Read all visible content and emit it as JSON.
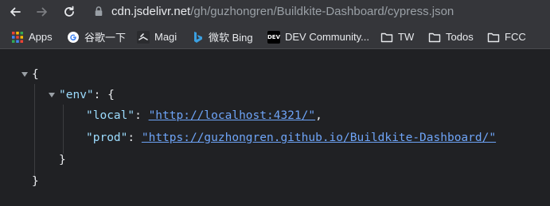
{
  "browser": {
    "url_host": "cdn.jsdelivr.net",
    "url_path": "/gh/guzhongren/Buildkite-Dashboard/cypress.json"
  },
  "bookmarks": [
    {
      "label": "Apps",
      "icon": "apps-grid-icon"
    },
    {
      "label": "谷歌一下",
      "icon": "google-icon"
    },
    {
      "label": "Magi",
      "icon": "magi-icon"
    },
    {
      "label": "微软 Bing",
      "icon": "bing-icon"
    },
    {
      "label": "DEV Community...",
      "icon": "dev-icon",
      "icon_text": "DEV"
    },
    {
      "label": "TW",
      "icon": "folder-icon"
    },
    {
      "label": "Todos",
      "icon": "folder-icon"
    },
    {
      "label": "FCC",
      "icon": "folder-icon"
    }
  ],
  "json": {
    "open_brace": "{",
    "env_key": "\"env\"",
    "colon": ":",
    "env_open": "{",
    "local_key": "\"local\"",
    "local_value": "\"http://localhost:4321/\"",
    "comma": ",",
    "prod_key": "\"prod\"",
    "prod_value": "\"https://guzhongren.github.io/Buildkite-Dashboard/\"",
    "env_close": "}",
    "close_brace": "}"
  },
  "colors": {
    "background": "#202124",
    "toolbar": "#35363a",
    "key": "#9cdcfe",
    "link": "#6ea4f7",
    "text": "#e8eaed"
  }
}
